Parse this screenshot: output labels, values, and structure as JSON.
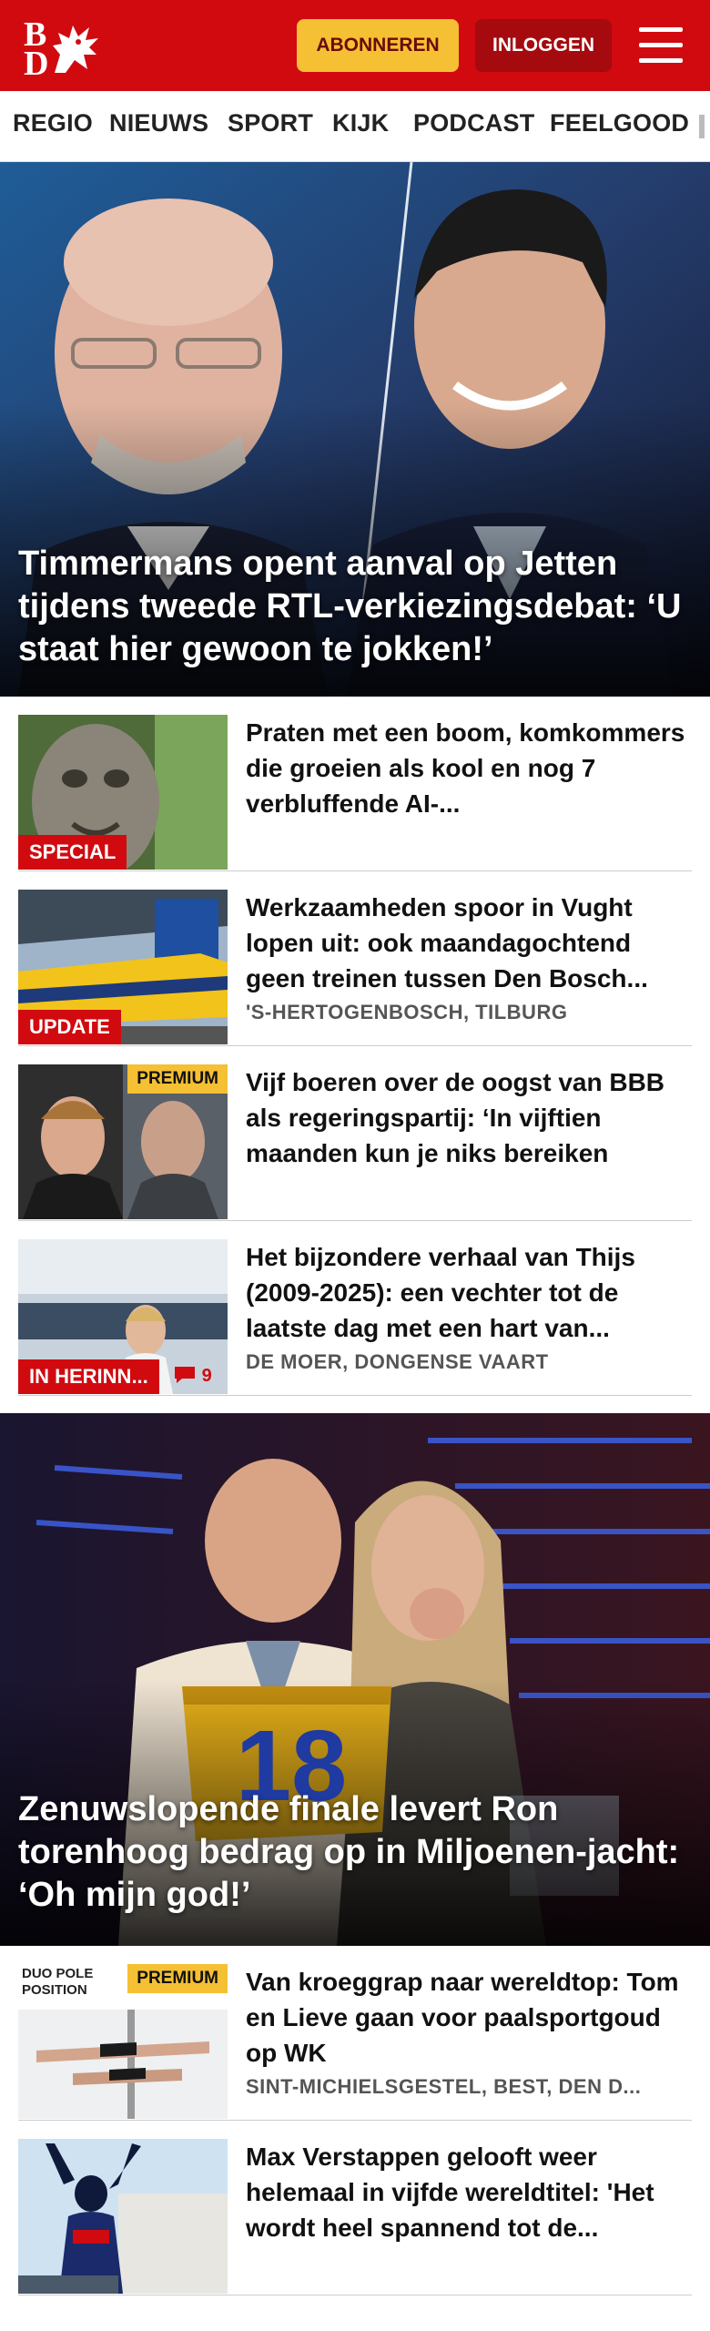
{
  "header": {
    "subscribe_label": "ABONNEREN",
    "login_label": "INLOGGEN",
    "logo_letters": [
      "B",
      "D"
    ],
    "brand_color": "#d10a10",
    "accent_color": "#f5c033"
  },
  "nav": {
    "items": [
      "REGIO",
      "NIEUWS",
      "SPORT",
      "KIJK",
      "PODCAST",
      "FEELGOOD"
    ]
  },
  "hero1": {
    "title": "Timmermans opent aanval op Jetten tijdens tweede RTL-verkiezingsdebat: ‘U staat hier gewoon te jokken!’"
  },
  "articles1": [
    {
      "title": "Praten met een boom, komkommers die groeien als kool en nog 7 verbluffende AI-...",
      "tag": "SPECIAL"
    },
    {
      "title": "Werkzaamheden spoor in Vught lopen uit: ook maandagochtend geen treinen tussen Den Bosch...",
      "meta": "'S-HERTOGENBOSCH, TILBURG",
      "tag": "UPDATE"
    },
    {
      "title": "Vijf boeren over de oogst van BBB als regeringspartij: ‘In vijftien maanden kun je niks bereiken",
      "premium": "PREMIUM"
    },
    {
      "title": "Het bijzondere verhaal van Thijs (2009-2025): een vechter tot de laatste dag met een hart van...",
      "meta": "DE MOER, DONGENSE VAART",
      "tag": "IN HERINN...",
      "comments": "9"
    }
  ],
  "hero2": {
    "title": "Zenuwslopende finale levert Ron torenhoog bedrag op in Miljoenen-jacht: ‘Oh mijn god!’",
    "podium_number": "18"
  },
  "articles2": [
    {
      "title": "Van kroeggrap naar wereldtop: Tom en Lieve gaan voor paalsportgoud op WK",
      "meta": "SINT-MICHIELSGESTEL, BEST, DEN D...",
      "premium": "PREMIUM",
      "thumb_text": "DUO POLE POSITION"
    },
    {
      "title": "Max Verstappen gelooft weer helemaal in vijfde wereldtitel: 'Het wordt heel spannend tot de..."
    }
  ]
}
